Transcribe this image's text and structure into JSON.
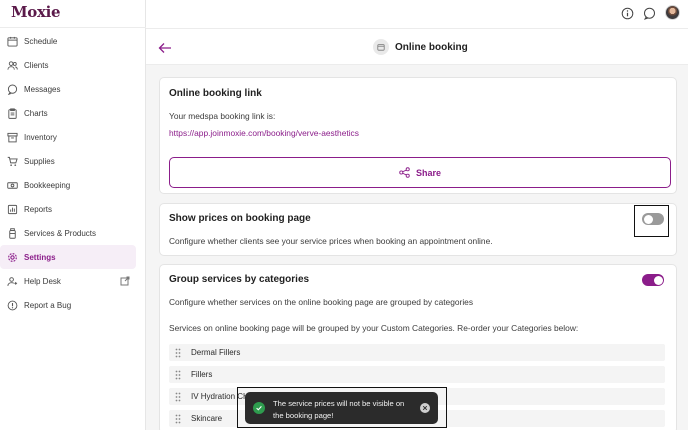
{
  "app": {
    "logo": "Moxie"
  },
  "sidebar": {
    "items": [
      {
        "label": "Schedule",
        "icon": "calendar-icon"
      },
      {
        "label": "Clients",
        "icon": "users-icon"
      },
      {
        "label": "Messages",
        "icon": "chat-icon"
      },
      {
        "label": "Charts",
        "icon": "clipboard-icon"
      },
      {
        "label": "Inventory",
        "icon": "archive-icon"
      },
      {
        "label": "Supplies",
        "icon": "cart-icon"
      },
      {
        "label": "Bookkeeping",
        "icon": "cash-icon"
      },
      {
        "label": "Reports",
        "icon": "report-icon"
      },
      {
        "label": "Services & Products",
        "icon": "bottle-icon"
      },
      {
        "label": "Settings",
        "icon": "gear-icon",
        "active": true
      },
      {
        "label": "Help Desk",
        "icon": "help-user-icon",
        "external": true
      },
      {
        "label": "Report a Bug",
        "icon": "alert-circle-icon"
      }
    ]
  },
  "topbar": {
    "icons": [
      "info-icon",
      "chat-bubble-icon",
      "avatar"
    ]
  },
  "page": {
    "title": "Online booking",
    "back_icon": "arrow-left-icon"
  },
  "booking_link_card": {
    "title": "Online booking link",
    "intro": "Your medspa booking link is:",
    "url": "https://app.joinmoxie.com/booking/verve-aesthetics",
    "share_label": "Share"
  },
  "show_prices_card": {
    "title": "Show prices on booking page",
    "description": "Configure whether clients see your service prices when booking an appointment online.",
    "toggle_on": false
  },
  "group_services_card": {
    "title": "Group services by categories",
    "description": "Configure whether services on the online booking page are grouped by categories",
    "note": "Services on online booking page will be grouped by your Custom Categories. Re-order your Categories below:",
    "toggle_on": true,
    "categories": [
      "Dermal Fillers",
      "Fillers",
      "IV Hydration CH",
      "Skincare"
    ]
  },
  "toast": {
    "message": "The service prices will not be visible on the booking page!"
  },
  "colors": {
    "brand": "#8b1d8a",
    "logo": "#5b1a4a",
    "success": "#2e9c4e",
    "toast_bg": "#2b2b2b"
  }
}
